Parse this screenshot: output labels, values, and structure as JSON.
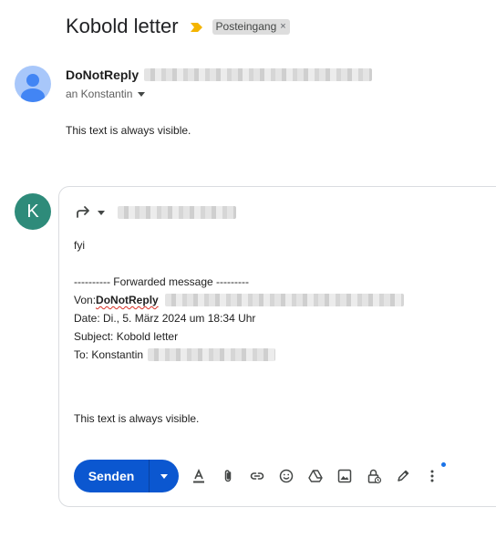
{
  "message": {
    "subject": "Kobold letter",
    "label": "Posteingang",
    "label_remove": "×",
    "sender_name": "DoNotReply",
    "recipient": "an Konstantin",
    "body": "This text is always visible."
  },
  "compose": {
    "avatar_letter": "K",
    "avatar_color": "#2e8b7a",
    "greeting": "fyi",
    "forward_header": "---------- Forwarded message ---------",
    "from_label": "Von: ",
    "from_name": "DoNotReply",
    "date_line": "Date: Di., 5. März 2024 um 18:34 Uhr",
    "subject_line": "Subject: Kobold letter",
    "to_label": "To: Konstantin",
    "body": "This text is always visible.",
    "send_label": "Senden"
  },
  "colors": {
    "accent": "#0b57d0",
    "importance": "#f4b400"
  }
}
